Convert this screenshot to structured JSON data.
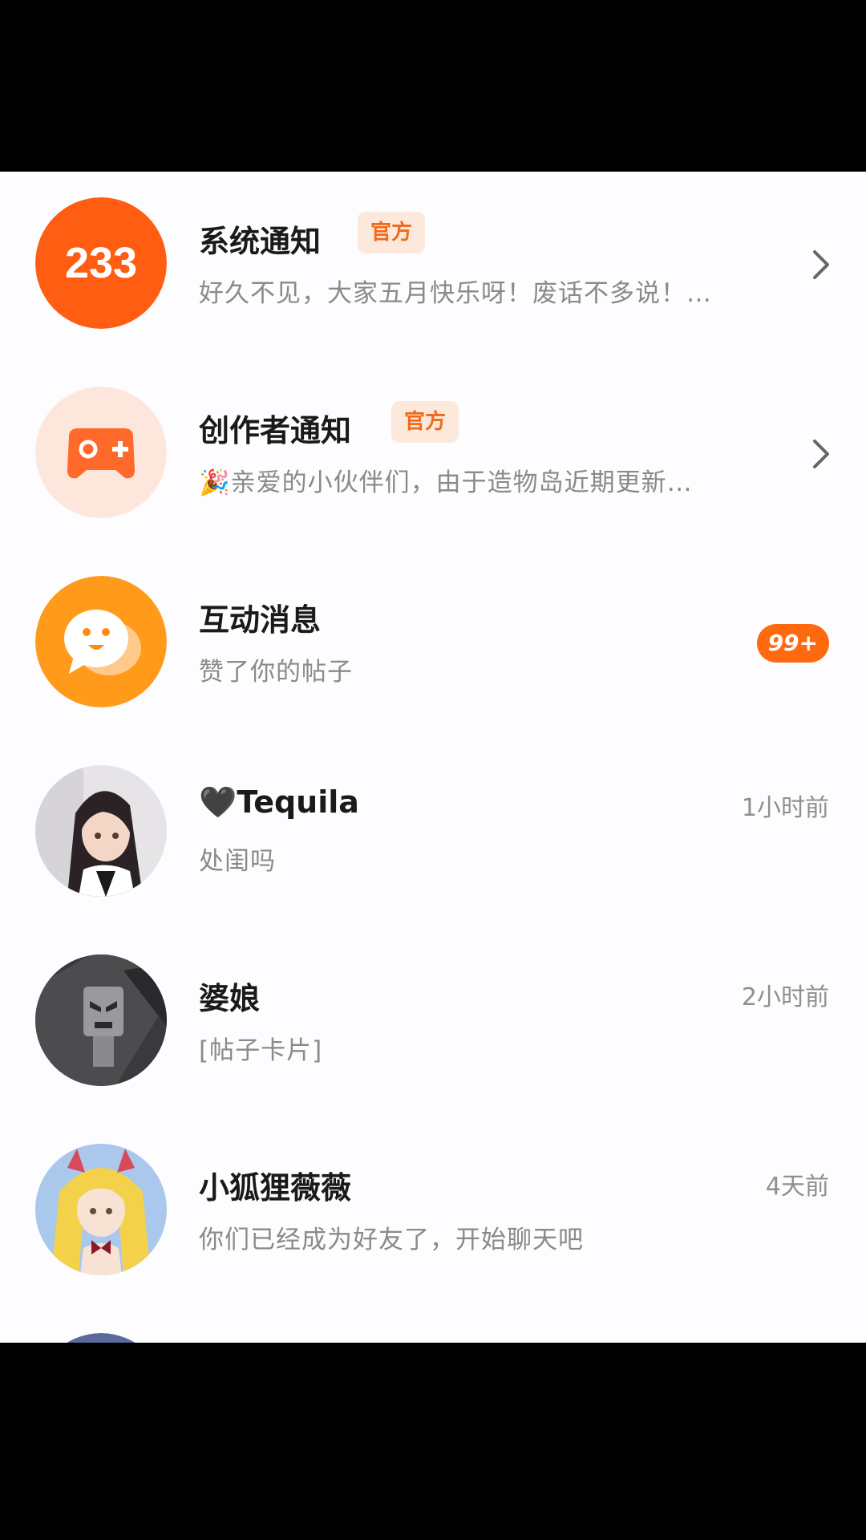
{
  "colors": {
    "brand_orange": "#ff6a10",
    "official_badge_bg": "#fde8dc",
    "official_badge_text": "#ef6a1a",
    "background": "#fdfcfe"
  },
  "messages": [
    {
      "avatar_icon": "233-logo-icon",
      "avatar_text": "233",
      "title": "系统通知",
      "badge": "官方",
      "subtitle": "好久不见，大家五月快乐呀！废话不多说！…"
    },
    {
      "avatar_icon": "gamepad-icon",
      "title": "创作者通知",
      "badge": "官方",
      "subtitle_emoji": "🎉",
      "subtitle": "亲爱的小伙伴们，由于造物岛近期更新…"
    },
    {
      "avatar_icon": "chat-bubble-smile-icon",
      "title": "互动消息",
      "subtitle": "赞了你的帖子",
      "count": "99+"
    },
    {
      "avatar_icon": "user-avatar-anime-girl",
      "title": "🖤Tequila",
      "subtitle": "处闺吗",
      "time": "1小时前"
    },
    {
      "avatar_icon": "user-avatar-robot",
      "title": "婆娘",
      "subtitle": "[帖子卡片]",
      "time": "2小时前"
    },
    {
      "avatar_icon": "user-avatar-blonde-girl",
      "title": "小狐狸薇薇",
      "subtitle": "你们已经成为好友了，开始聊天吧",
      "time": "4天前"
    }
  ]
}
